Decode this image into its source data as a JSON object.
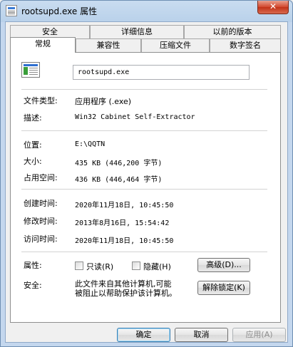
{
  "window": {
    "title": "rootsupd.exe 属性",
    "close_label": "✕"
  },
  "tabs_row1": [
    "安全",
    "详细信息",
    "以前的版本"
  ],
  "tabs_row2": [
    "常规",
    "兼容性",
    "压缩文件",
    "数字签名"
  ],
  "general": {
    "file_name": "rootsupd.exe",
    "file_type_label": "文件类型:",
    "file_type_value": "应用程序 (.exe)",
    "desc_label": "描述:",
    "desc_value": "Win32 Cabinet Self-Extractor",
    "location_label": "位置:",
    "location_value": "E:\\QQTN",
    "size_label": "大小:",
    "size_value": "435 KB (446,200 字节)",
    "disk_size_label": "占用空间:",
    "disk_size_value": "436 KB (446,464 字节)",
    "created_label": "创建时间:",
    "created_value": "2020年11月18日, 10:45:50",
    "modified_label": "修改时间:",
    "modified_value": "2013年8月16日, 15:54:42",
    "accessed_label": "访问时间:",
    "accessed_value": "2020年11月18日, 10:45:50",
    "attributes_label": "属性:",
    "readonly_label": "只读(R)",
    "hidden_label": "隐藏(H)",
    "advanced_label": "高级(D)...",
    "security_label": "安全:",
    "security_line1": "此文件来自其他计算机,可能",
    "security_line2": "被阻止以帮助保护该计算机。",
    "unblock_label": "解除锁定(K)"
  },
  "footer": {
    "ok": "确定",
    "cancel": "取消",
    "apply": "应用(A)"
  }
}
